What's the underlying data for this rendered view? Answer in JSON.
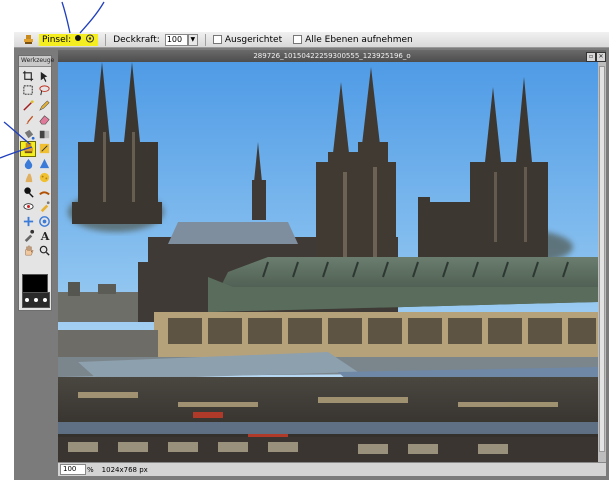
{
  "optbar": {
    "brush_label": "Pinsel:",
    "opacity_label": "Deckkraft:",
    "opacity_value": "100",
    "aligned_label": "Ausgerichtet",
    "sample_all_label": "Alle Ebenen aufnehmen"
  },
  "toolbox": {
    "title": "Werkzeuge",
    "tools": [
      "crop-icon",
      "move-icon",
      "marquee-icon",
      "lasso-icon",
      "wand-icon",
      "pencil-icon",
      "brush-icon",
      "eraser-icon",
      "bucket-icon",
      "gradient-icon",
      "clone-stamp-icon",
      "color-replace-icon",
      "blur-icon",
      "sharpen-icon",
      "smudge-icon",
      "sponge-icon",
      "dodge-icon",
      "burn-icon",
      "red-eye-icon",
      "spot-heal-icon",
      "bloat-icon",
      "pinch-icon",
      "eyedropper-icon",
      "type-icon",
      "hand-icon",
      "zoom-icon"
    ],
    "active_tool": "clone-stamp-icon"
  },
  "document": {
    "title": "289726_10150422259300555_123925196_o"
  },
  "status": {
    "zoom": "100",
    "zoom_unit": "%",
    "dimensions": "1024x768 px"
  },
  "colors": {
    "highlight": "#f4ee20",
    "annotation_ink": "#1f3fbf"
  }
}
